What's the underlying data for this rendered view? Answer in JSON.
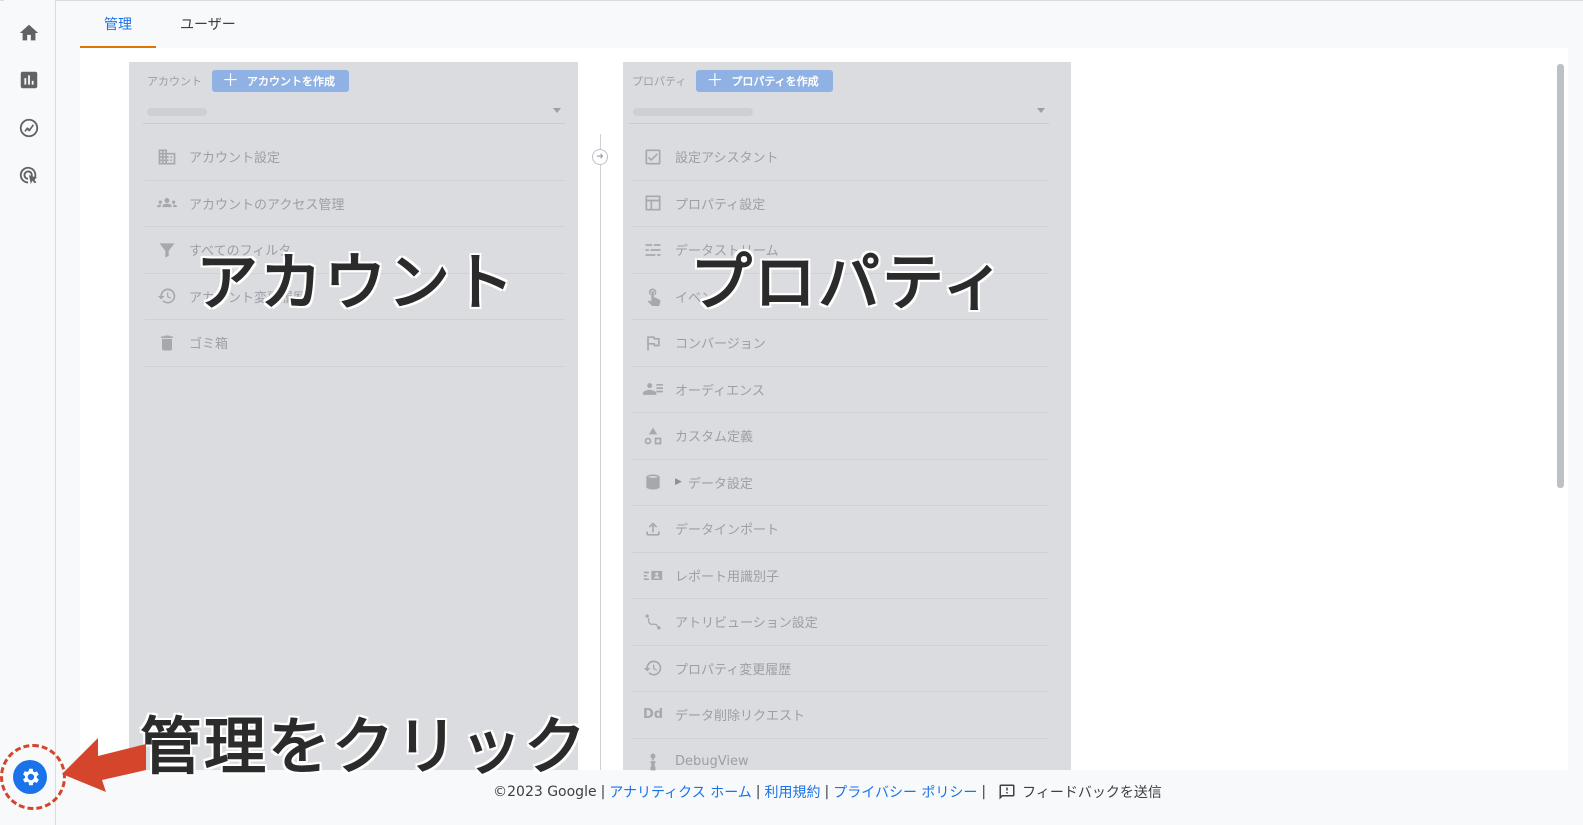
{
  "tabs": [
    {
      "label": "管理",
      "active": true
    },
    {
      "label": "ユーザー",
      "active": false
    }
  ],
  "account": {
    "header_label": "アカウント",
    "create_label": "アカウントを作成",
    "items": [
      {
        "icon": "building-icon",
        "label": "アカウント設定"
      },
      {
        "icon": "people-icon",
        "label": "アカウントのアクセス管理"
      },
      {
        "icon": "filter-icon",
        "label": "すべてのフィルタ"
      },
      {
        "icon": "history-icon",
        "label": "アカウント変更履歴"
      },
      {
        "icon": "trash-icon",
        "label": "ゴミ箱"
      }
    ]
  },
  "property": {
    "header_label": "プロパティ",
    "create_label": "プロパティを作成",
    "items": [
      {
        "icon": "checkbox-icon",
        "label": "設定アシスタント"
      },
      {
        "icon": "layout-icon",
        "label": "プロパティ設定"
      },
      {
        "icon": "data-streams-icon",
        "label": "データストリーム"
      },
      {
        "icon": "touch-icon",
        "label": "イベント"
      },
      {
        "icon": "flag-icon",
        "label": "コンバージョン"
      },
      {
        "icon": "audience-icon",
        "label": "オーディエンス"
      },
      {
        "icon": "shapes-icon",
        "label": "カスタム定義"
      },
      {
        "icon": "database-icon",
        "label": "データ設定"
      },
      {
        "icon": "upload-icon",
        "label": "データインポート"
      },
      {
        "icon": "id-icon",
        "label": "レポート用識別子"
      },
      {
        "icon": "attribution-icon",
        "label": "アトリビューション設定"
      },
      {
        "icon": "history-icon",
        "label": "プロパティ変更履歴"
      },
      {
        "icon": "dd-icon",
        "label": "データ削除リクエスト"
      },
      {
        "icon": "debug-icon",
        "label": "DebugView"
      }
    ]
  },
  "overlays": {
    "account": "アカウント",
    "property": "プロパティ",
    "click": "管理をクリック"
  },
  "footer": {
    "copyright": "©2023 Google",
    "home": "アナリティクス ホーム",
    "terms": "利用規約",
    "privacy": "プライバシー ポリシー",
    "feedback": "フィードバックを送信"
  },
  "colors": {
    "accent": "#1a73e8",
    "tab_underline": "#e37400",
    "annotation_red": "#d4452c"
  }
}
